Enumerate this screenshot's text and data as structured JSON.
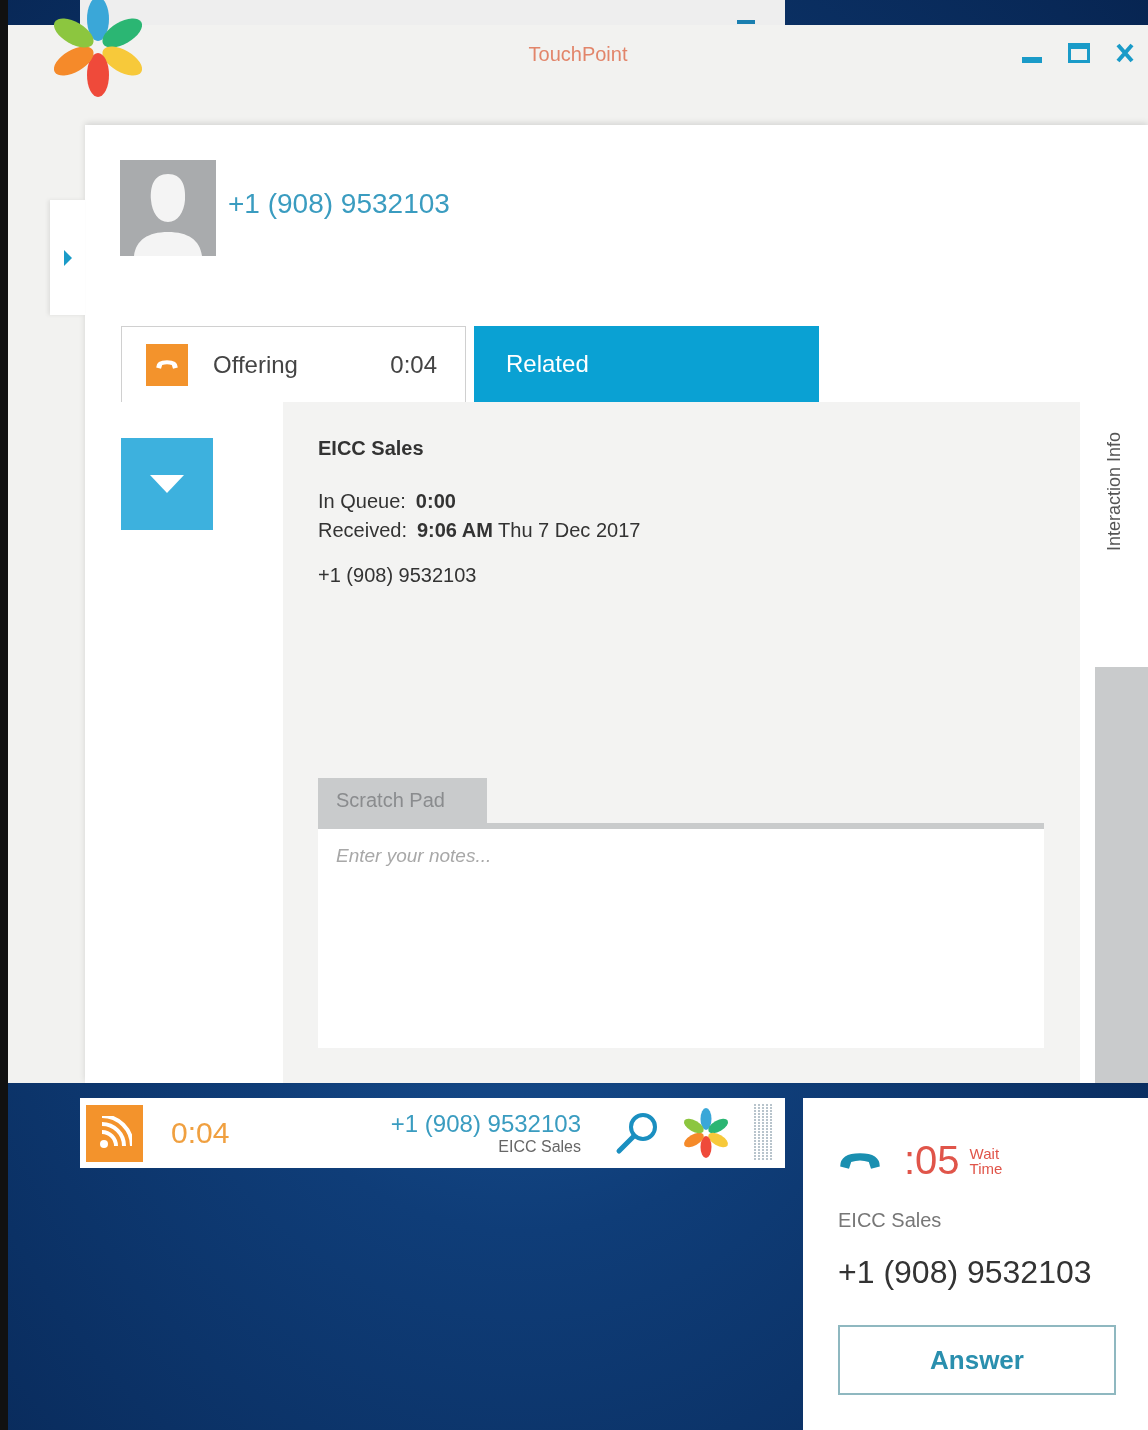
{
  "window": {
    "title": "TouchPoint"
  },
  "contact": {
    "phone": "+1 (908) 9532103"
  },
  "tabs": [
    {
      "kind": "status",
      "label": "Offering",
      "timer": "0:04",
      "selected": true
    },
    {
      "kind": "plain",
      "label": "Related",
      "selected": false
    }
  ],
  "interaction": {
    "queue": "EICC Sales",
    "details": [
      {
        "label": "In Queue:",
        "value": "**0:00**"
      },
      {
        "label": "Received:",
        "value": "**9:06 AM** Thu 7 Dec 2017"
      }
    ],
    "phone": "+1 (908) 9532103"
  },
  "scratch_pad": {
    "tab": "Scratch Pad",
    "placeholder": "Enter your notes..."
  },
  "side_panel": {
    "label": "Interaction Info"
  },
  "call_bar": {
    "timer": "0:04",
    "phone": "+1 (908) 9532103",
    "queue": "EICC Sales"
  },
  "notification": {
    "wait": ":05",
    "wait_label": "Wait Time",
    "queue": "EICC Sales",
    "phone": "+1 (908) 9532103",
    "button": "Answer"
  }
}
